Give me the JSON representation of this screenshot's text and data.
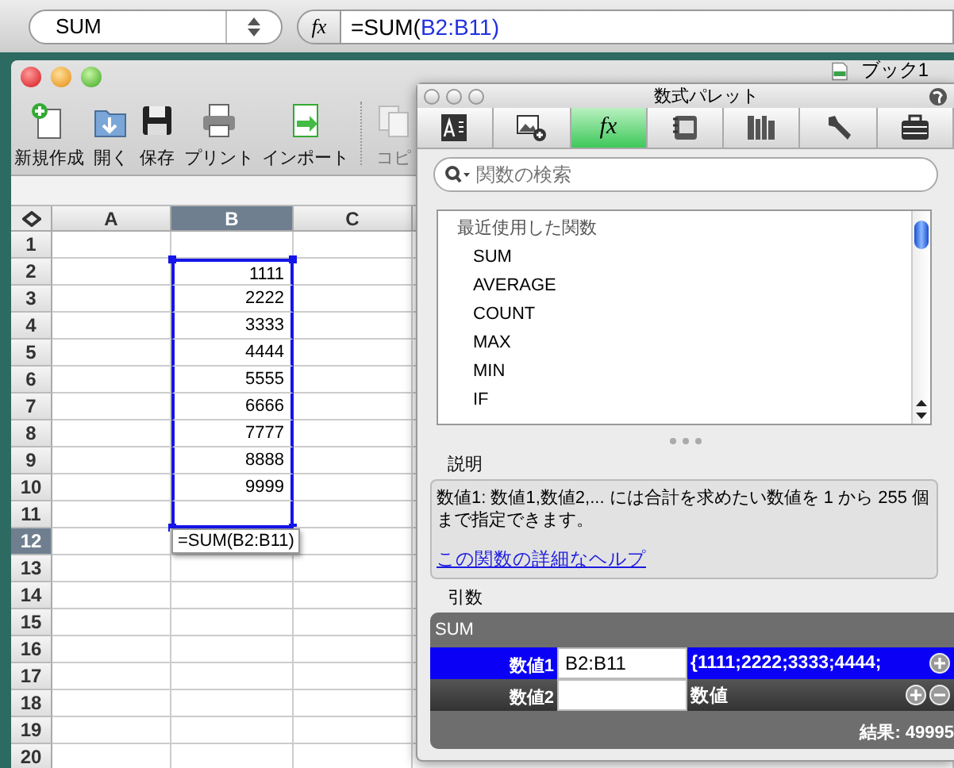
{
  "formula_bar": {
    "name_box": "SUM",
    "fx_label": "fx",
    "formula": [
      {
        "kind": "plain",
        "text": "=SUM("
      },
      {
        "kind": "ref",
        "text": "B2:B11)"
      }
    ]
  },
  "window": {
    "title": "ブック1"
  },
  "toolbar": [
    {
      "kind": "new",
      "label": "新規作成",
      "disabled": false
    },
    {
      "kind": "open",
      "label": "開く",
      "disabled": false
    },
    {
      "kind": "save",
      "label": "保存",
      "disabled": false
    },
    {
      "kind": "print",
      "label": "プリント",
      "disabled": false
    },
    {
      "kind": "import",
      "label": "インポート",
      "disabled": false
    },
    {
      "kind": "copy",
      "label": "コピ",
      "disabled": true
    }
  ],
  "sheet": {
    "columns": [
      {
        "label": "A",
        "selected": false
      },
      {
        "label": "B",
        "selected": true
      },
      {
        "label": "C",
        "selected": false
      }
    ],
    "rows": [
      {
        "label": "1",
        "selected": false,
        "in_selection": false
      },
      {
        "label": "2",
        "selected": false,
        "in_selection": true,
        "column_b": "1111"
      },
      {
        "label": "3",
        "selected": false,
        "in_selection": true,
        "column_b": "2222"
      },
      {
        "label": "4",
        "selected": false,
        "in_selection": true,
        "column_b": "3333"
      },
      {
        "label": "5",
        "selected": false,
        "in_selection": true,
        "column_b": "4444"
      },
      {
        "label": "6",
        "selected": false,
        "in_selection": true,
        "column_b": "5555"
      },
      {
        "label": "7",
        "selected": false,
        "in_selection": true,
        "column_b": "6666"
      },
      {
        "label": "8",
        "selected": false,
        "in_selection": true,
        "column_b": "7777"
      },
      {
        "label": "9",
        "selected": false,
        "in_selection": true,
        "column_b": "8888"
      },
      {
        "label": "10",
        "selected": false,
        "in_selection": true,
        "column_b": "9999"
      },
      {
        "label": "11",
        "selected": false,
        "in_selection": true
      },
      {
        "label": "12",
        "selected": true,
        "in_selection": false
      },
      {
        "label": "13",
        "selected": false,
        "in_selection": false
      },
      {
        "label": "14",
        "selected": false,
        "in_selection": false
      },
      {
        "label": "15",
        "selected": false,
        "in_selection": false
      },
      {
        "label": "16",
        "selected": false,
        "in_selection": false
      },
      {
        "label": "17",
        "selected": false,
        "in_selection": false
      },
      {
        "label": "18",
        "selected": false,
        "in_selection": false
      },
      {
        "label": "19",
        "selected": false,
        "in_selection": false
      },
      {
        "label": "20",
        "selected": false,
        "in_selection": false
      }
    ],
    "tooltip": "=SUM(B2:B11)"
  },
  "palette": {
    "title": "数式パレット",
    "tabs": [
      {
        "kind": "format",
        "selected": false
      },
      {
        "kind": "picture",
        "selected": false
      },
      {
        "kind": "function",
        "label": "fx",
        "selected": true
      },
      {
        "kind": "gallery",
        "selected": false
      },
      {
        "kind": "library",
        "selected": false
      },
      {
        "kind": "tools",
        "selected": false
      },
      {
        "kind": "toolbox",
        "selected": false
      }
    ],
    "search": {
      "placeholder": "関数の検索"
    },
    "function_list": {
      "heading": "最近使用した関数",
      "items": [
        "SUM",
        "AVERAGE",
        "COUNT",
        "MAX",
        "MIN",
        "IF"
      ]
    },
    "description": {
      "label": "説明",
      "text": "数値1: 数値1,数値2,... には合計を求めたい数値を 1 から 255 個まで指定できます。",
      "help_link": "この関数の詳細なヘルプ"
    },
    "arguments": {
      "label": "引数",
      "function": "SUM",
      "rows": [
        {
          "name": "数値1",
          "value": "B2:B11",
          "result": "{1111;2222;3333;4444;",
          "selected": true,
          "removable": false
        },
        {
          "name": "数値2",
          "result": "数値",
          "selected": false,
          "removable": true
        }
      ],
      "result": "結果: 49995"
    }
  }
}
